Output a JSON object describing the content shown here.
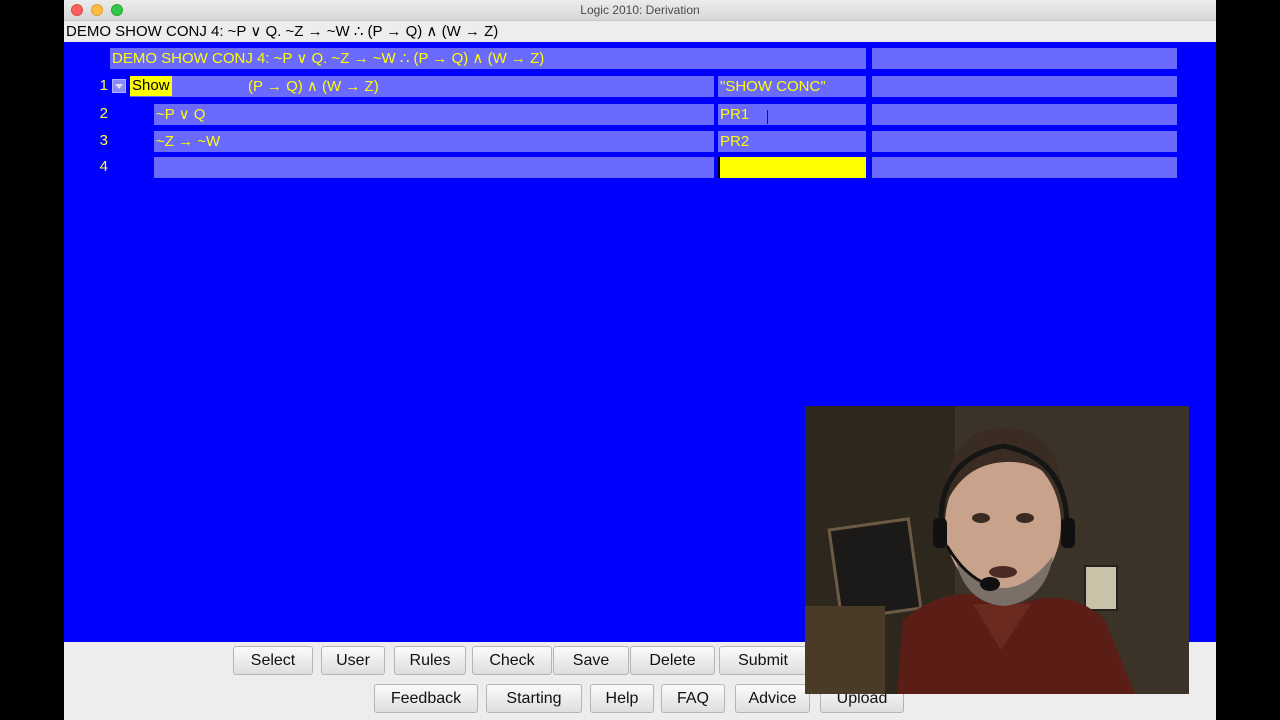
{
  "window": {
    "title": "Logic 2010: Derivation"
  },
  "problem_header": "DEMO SHOW CONJ 4:  ~P ∨ Q. ~Z → ~W ∴ (P → Q) ∧ (W → Z)",
  "derivation": {
    "title_cell": "DEMO SHOW CONJ 4:  ~P ∨ Q. ~Z → ~W ∴ (P → Q) ∧ (W → Z)",
    "lines": [
      {
        "num": "1",
        "show": "Show",
        "formula": "(P → Q) ∧ (W → Z)",
        "justification": "\"SHOW CONC\""
      },
      {
        "num": "2",
        "formula": "~P ∨ Q",
        "justification": "PR1"
      },
      {
        "num": "3",
        "formula": "~Z → ~W",
        "justification": "PR2"
      },
      {
        "num": "4",
        "formula": "",
        "justification": ""
      }
    ]
  },
  "buttons_row1": [
    "Select",
    "User",
    "Rules",
    "Check",
    "Save",
    "Delete",
    "Submit"
  ],
  "buttons_row2": [
    "Feedback",
    "Starting",
    "Help",
    "FAQ",
    "Advice",
    "Upload"
  ],
  "colors": {
    "workspace": "#0000ff",
    "cell": "#6a6aff",
    "text": "#ffff00",
    "active_cell": "#ffff00"
  }
}
